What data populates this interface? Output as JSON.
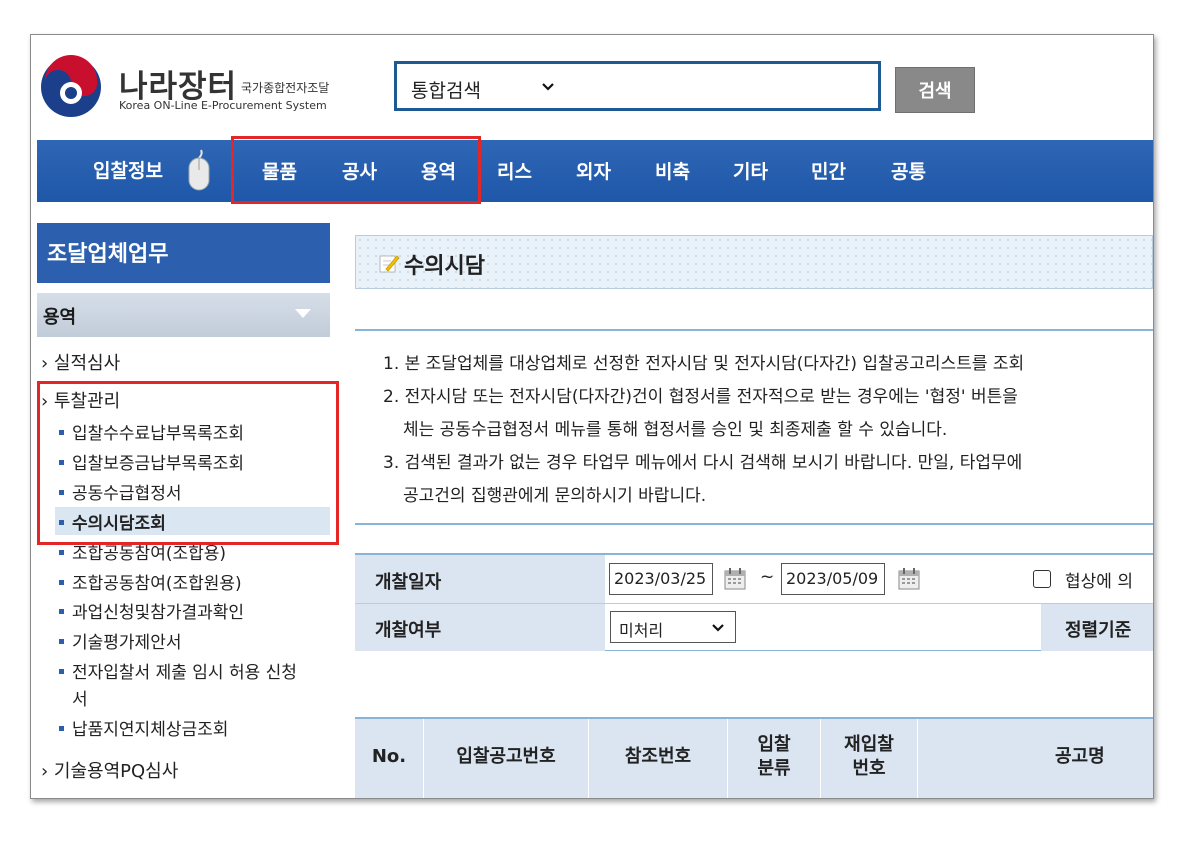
{
  "header": {
    "logo_title": "나라장터",
    "logo_subtitle": "국가종합전자조달",
    "logo_english": "Korea ON-Line E-Procurement System",
    "search_select": "통합검색",
    "search_button": "검색"
  },
  "nav": {
    "bid_info": "입찰정보",
    "items": [
      "물품",
      "공사",
      "용역",
      "리스",
      "외자",
      "비축",
      "기타",
      "민간",
      "공통"
    ]
  },
  "sidebar": {
    "title": "조달업체업무",
    "section": "용역",
    "items": [
      {
        "label": "실적심사"
      },
      {
        "label": "투찰관리"
      },
      {
        "label": "입찰수수료납부목록조회"
      },
      {
        "label": "입찰보증금납부목록조회"
      },
      {
        "label": "공동수급협정서"
      },
      {
        "label": "수의시담조회"
      },
      {
        "label": "조합공동참여(조합용)"
      },
      {
        "label": "조합공동참여(조합원용)"
      },
      {
        "label": "과업신청및참가결과확인"
      },
      {
        "label": "기술평가제안서"
      },
      {
        "label": "전자입찰서 제출 임시 허용 신청"
      },
      {
        "label": "서"
      },
      {
        "label": "납품지연지체상금조회"
      },
      {
        "label": "기술용역PQ심사"
      }
    ]
  },
  "content": {
    "title": "수의시담",
    "info": [
      "1. 본 조달업체를 대상업체로 선정한 전자시담 및 전자시담(다자간) 입찰공고리스트를 조회",
      "2. 전자시담 또는 전자시담(다자간)건이 협정서를 전자적으로 받는 경우에는 '협정' 버튼을",
      "체는 공동수급협정서 메뉴를 통해 협정서를 승인 및 최종제출 할 수 있습니다.",
      "3. 검색된 결과가 없는 경우 타업무 메뉴에서 다시 검색해 보시기 바랍니다. 만일, 타업무에",
      "공고건의 집행관에게 문의하시기 바랍니다."
    ],
    "form": {
      "open_date_label": "개찰일자",
      "date_from": "2023/03/25",
      "tilde": "~",
      "date_to": "2023/05/09",
      "negotiation_label": "협상에 의",
      "open_status_label": "개찰여부",
      "open_status_value": "미처리",
      "sort_label": "정렬기준"
    },
    "table": {
      "headers": [
        "No.",
        "입찰공고번호",
        "참조번호",
        "입찰",
        "분류",
        "재입찰",
        "번호",
        "공고명"
      ]
    }
  }
}
